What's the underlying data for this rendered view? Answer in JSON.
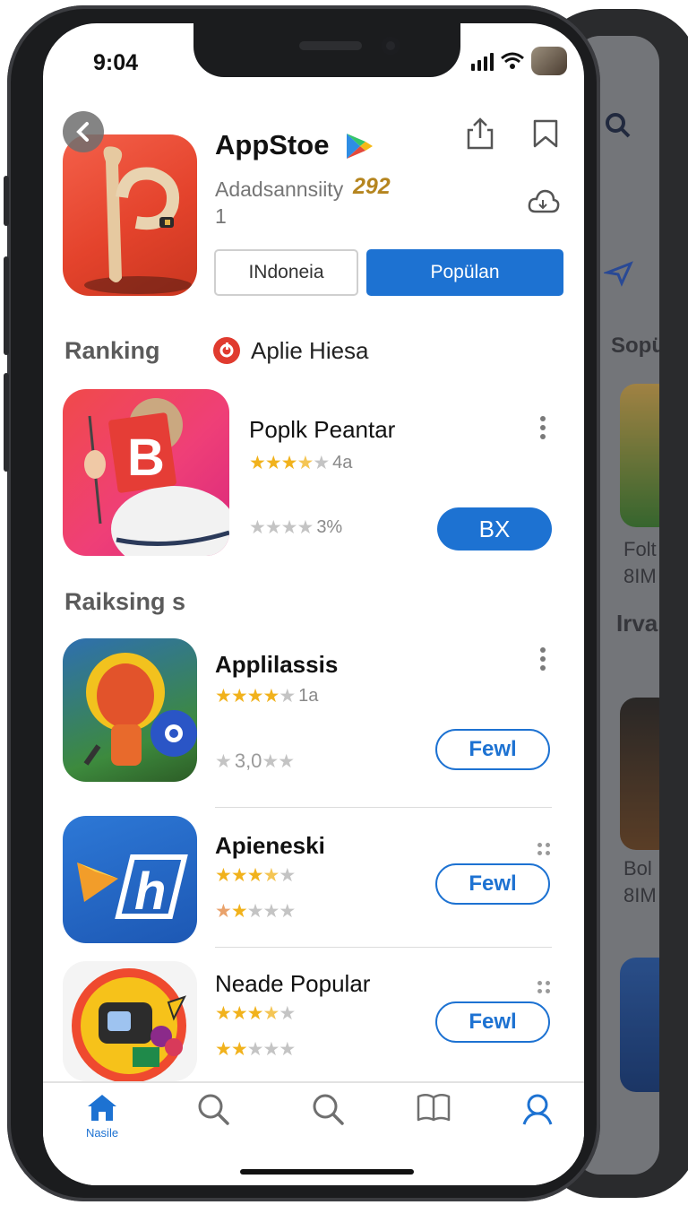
{
  "status": {
    "time": "9:04"
  },
  "app": {
    "title": "AppStoe",
    "subtitle": "Adadsannsiity",
    "rating": "292",
    "count": "1",
    "buttons": {
      "region": "INdoneia",
      "primary": "Popülan"
    }
  },
  "ranking": {
    "title": "Ranking",
    "chip": "Aplie Hiesa",
    "item": {
      "name": "Poplk Peantar",
      "rating_label": "4a",
      "stars_filled": 3.5,
      "secondary_label": "3%",
      "action": "BX"
    }
  },
  "section2": {
    "title": "Raiksing s",
    "items": [
      {
        "name": "Applilassis",
        "rating_label": "1a",
        "stars_filled": 4,
        "secondary_label": "3,0",
        "action": "Fewl"
      },
      {
        "name": "Apieneski",
        "rating_label": "",
        "stars_filled": 3.5,
        "action": "Fewl"
      },
      {
        "name": "Neade Popular",
        "rating_label": "",
        "stars_filled": 3.5,
        "action": "Fewl"
      }
    ]
  },
  "background_phone": {
    "labels": [
      "Sopü",
      "Folt",
      "8IM",
      "Irva",
      "Bol",
      "8IM"
    ]
  },
  "tabbar": {
    "tabs": [
      {
        "label": "Nasile",
        "icon": "home-icon",
        "active": true
      },
      {
        "label": "",
        "icon": "search-icon"
      },
      {
        "label": "",
        "icon": "search-icon"
      },
      {
        "label": "",
        "icon": "book-icon"
      },
      {
        "label": "",
        "icon": "profile-icon"
      }
    ]
  },
  "colors": {
    "accent": "#1d72d2",
    "star": "#f1b21c"
  }
}
